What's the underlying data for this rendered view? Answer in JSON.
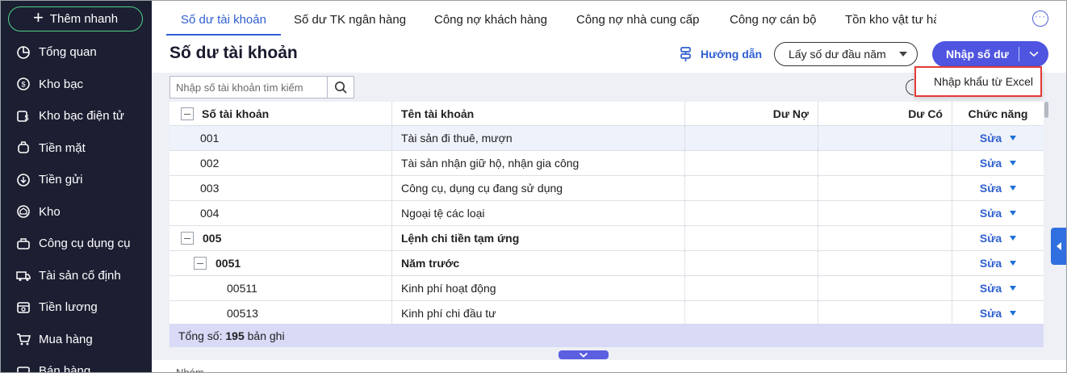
{
  "sidebar": {
    "quick_add_label": "Thêm nhanh",
    "items": [
      {
        "label": "Tổng quan",
        "icon": "pie-chart-icon"
      },
      {
        "label": "Kho bạc",
        "icon": "treasury-icon"
      },
      {
        "label": "Kho bạc điện tử",
        "icon": "e-treasury-icon"
      },
      {
        "label": "Tiền mặt",
        "icon": "cash-icon"
      },
      {
        "label": "Tiền gửi",
        "icon": "deposit-icon"
      },
      {
        "label": "Kho",
        "icon": "warehouse-icon"
      },
      {
        "label": "Công cụ dụng cụ",
        "icon": "tools-icon"
      },
      {
        "label": "Tài sản cố định",
        "icon": "fixed-asset-icon"
      },
      {
        "label": "Tiền lương",
        "icon": "salary-icon"
      },
      {
        "label": "Mua hàng",
        "icon": "cart-icon"
      },
      {
        "label": "Bán hàng",
        "icon": "sales-icon"
      }
    ]
  },
  "tabs": [
    {
      "label": "Số dư tài khoản",
      "active": true
    },
    {
      "label": "Số dư TK ngân hàng",
      "active": false
    },
    {
      "label": "Công nợ khách hàng",
      "active": false
    },
    {
      "label": "Công nợ nhà cung cấp",
      "active": false
    },
    {
      "label": "Công nợ cán bộ",
      "active": false
    },
    {
      "label": "Tồn kho vật tư hà",
      "active": false
    }
  ],
  "header": {
    "title": "Số dư tài khoản",
    "guide_label": "Hướng dẫn",
    "opening_balance_label": "Lấy số dư đầu năm",
    "enter_balance_label": "Nhập số dư"
  },
  "dropdown": {
    "import_excel_label": "Nhập khẩu từ Excel"
  },
  "search": {
    "placeholder": "Nhập số tài khoản tìm kiếm"
  },
  "table": {
    "columns": {
      "code": "Số tài khoản",
      "name": "Tên tài khoản",
      "debit": "Dư Nợ",
      "credit": "Dư Có",
      "actions": "Chức năng"
    },
    "edit_label": "Sửa",
    "rows": [
      {
        "code": "001",
        "name": "Tài sản đi thuê, mượn",
        "level": 0,
        "group": false
      },
      {
        "code": "002",
        "name": "Tài sản nhận giữ hộ, nhận gia công",
        "level": 0,
        "group": false
      },
      {
        "code": "003",
        "name": "Công cụ, dụng cụ đang sử dụng",
        "level": 0,
        "group": false
      },
      {
        "code": "004",
        "name": "Ngoại tệ các loại",
        "level": 0,
        "group": false
      },
      {
        "code": "005",
        "name": "Lệnh chi tiền tạm ứng",
        "level": 0,
        "group": true
      },
      {
        "code": "0051",
        "name": "Năm trước",
        "level": 1,
        "group": true
      },
      {
        "code": "00511",
        "name": "Kinh phí hoạt động",
        "level": 2,
        "group": false
      },
      {
        "code": "00513",
        "name": "Kinh phí chi đầu tư",
        "level": 2,
        "group": false
      }
    ]
  },
  "footer": {
    "total_prefix": "Tổng số:",
    "total_count": "195",
    "total_suffix": "bản ghi"
  },
  "bottom": {
    "partial_text": "Nhóm"
  }
}
